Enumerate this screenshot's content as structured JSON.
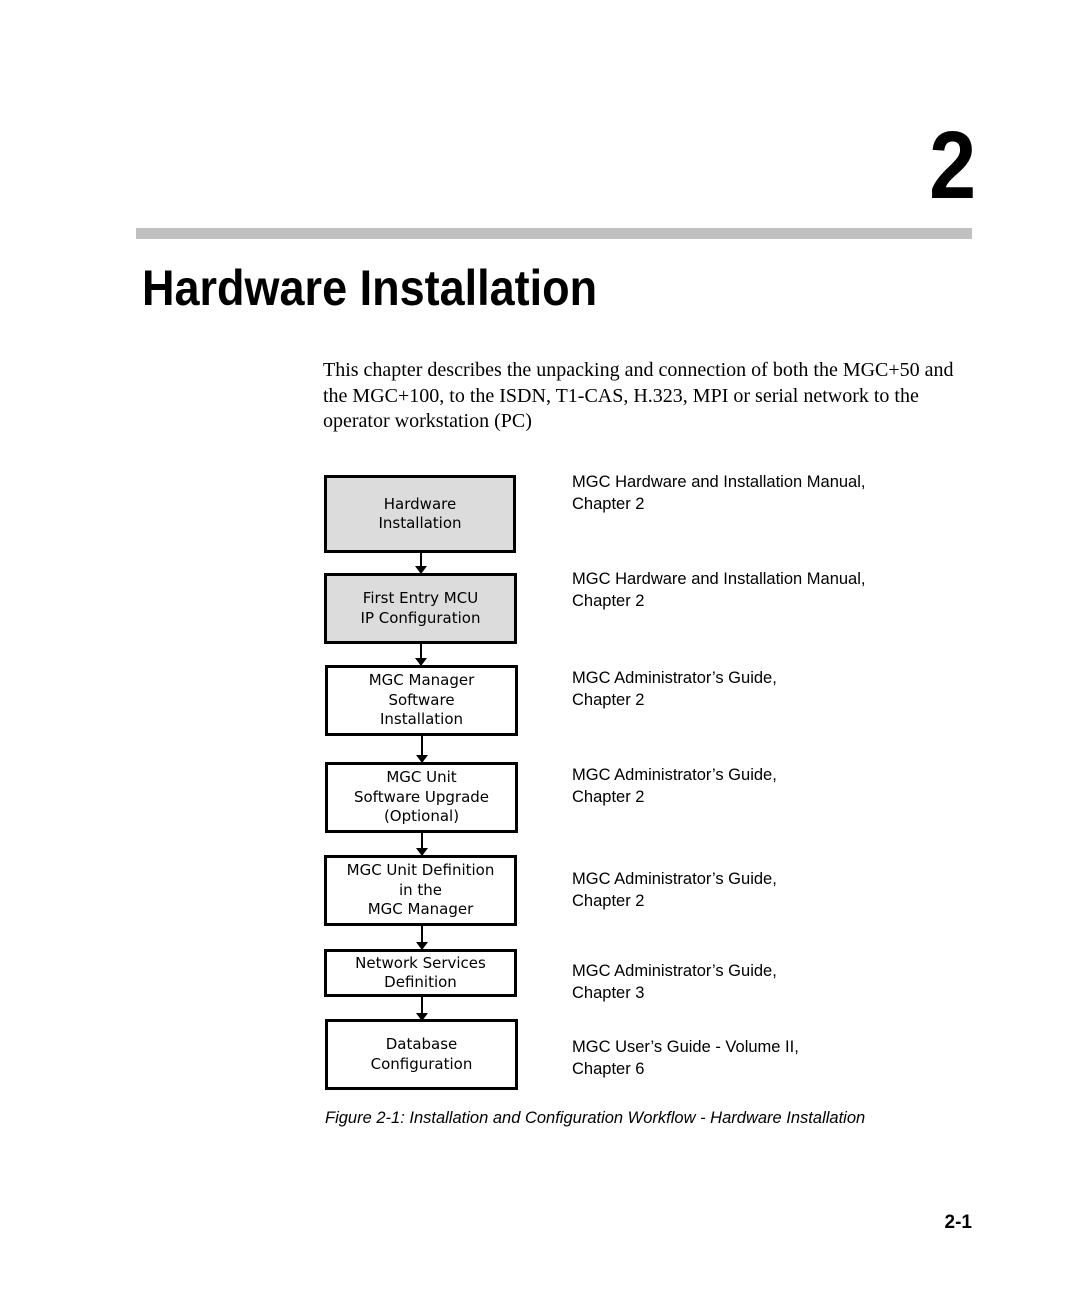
{
  "chapter": {
    "number": "2",
    "title": "Hardware Installation"
  },
  "intro": "This chapter describes the unpacking and connection of both the MGC+50 and the MGC+100, to the ISDN, T1-CAS, H.323, MPI or serial network to the operator workstation (PC)",
  "workflow": {
    "steps": [
      {
        "label": "Hardware\nInstallation",
        "shaded": true,
        "reference": "MGC Hardware and Installation Manual,\nChapter 2"
      },
      {
        "label": "First Entry MCU\nIP Configuration",
        "shaded": true,
        "reference": "MGC Hardware and Installation Manual,\nChapter 2"
      },
      {
        "label": "MGC Manager\nSoftware\nInstallation",
        "shaded": false,
        "reference": "MGC Administrator’s Guide,\nChapter 2"
      },
      {
        "label": "MGC Unit\nSoftware Upgrade\n(Optional)",
        "shaded": false,
        "reference": "MGC Administrator’s Guide,\nChapter 2"
      },
      {
        "label": "MGC Unit Definition\nin the\nMGC Manager",
        "shaded": false,
        "reference": "MGC Administrator’s Guide,\nChapter 2"
      },
      {
        "label": "Network Services\nDefinition",
        "shaded": false,
        "reference": "MGC Administrator’s Guide,\nChapter 3"
      },
      {
        "label": "Database\nConfiguration",
        "shaded": false,
        "reference": "MGC User’s Guide - Volume II,\nChapter 6"
      }
    ],
    "caption": "Figure 2-1: Installation and Configuration Workflow - Hardware Installation"
  },
  "footer": {
    "page_number": "2-1"
  }
}
